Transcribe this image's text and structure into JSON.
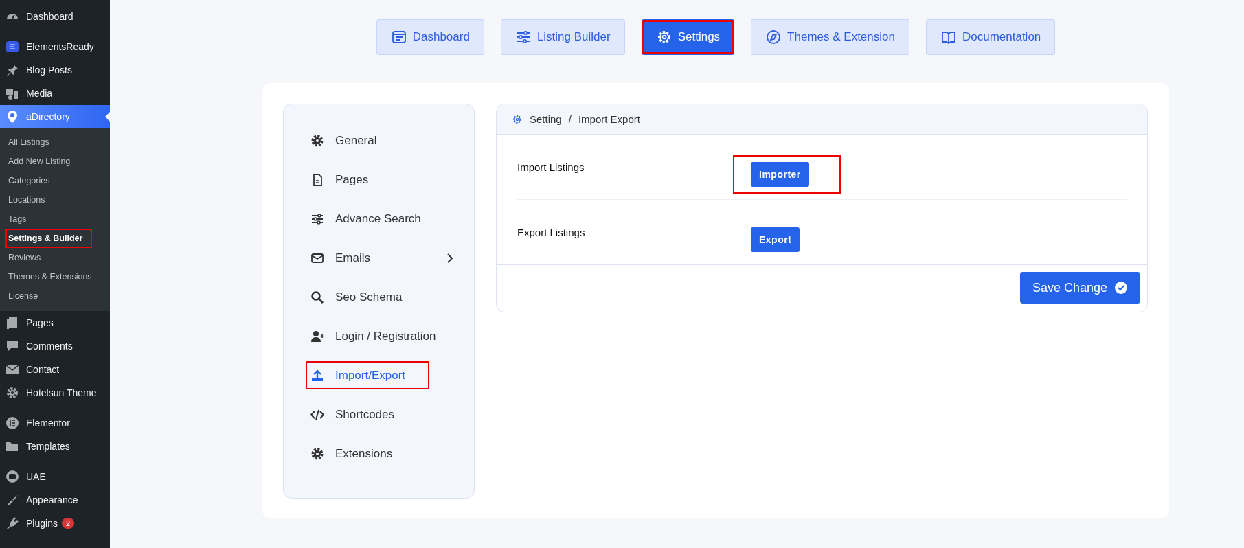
{
  "admin_menu": {
    "groups": [
      [
        {
          "label": "Dashboard",
          "selected": false
        }
      ],
      [
        {
          "label": "ElementsReady",
          "selected": false
        },
        {
          "label": "Blog Posts",
          "selected": false
        },
        {
          "label": "Media",
          "selected": false
        },
        {
          "label": "aDirectory",
          "selected": true,
          "submenu": [
            {
              "label": "All Listings",
              "selected": false,
              "highlighted": false
            },
            {
              "label": "Add New Listing",
              "selected": false,
              "highlighted": false
            },
            {
              "label": "Categories",
              "selected": false,
              "highlighted": false
            },
            {
              "label": "Locations",
              "selected": false,
              "highlighted": false
            },
            {
              "label": "Tags",
              "selected": false,
              "highlighted": false
            },
            {
              "label": "Settings & Builder",
              "selected": true,
              "highlighted": true
            },
            {
              "label": "Reviews",
              "selected": false,
              "highlighted": false
            },
            {
              "label": "Themes & Extensions",
              "selected": false,
              "highlighted": false
            },
            {
              "label": "License",
              "selected": false,
              "highlighted": false
            }
          ]
        },
        {
          "label": "Pages",
          "selected": false
        },
        {
          "label": "Comments",
          "selected": false
        },
        {
          "label": "Contact",
          "selected": false
        },
        {
          "label": "Hotelsun Theme",
          "selected": false
        }
      ],
      [
        {
          "label": "Elementor",
          "selected": false
        },
        {
          "label": "Templates",
          "selected": false
        }
      ],
      [
        {
          "label": "UAE",
          "selected": false
        },
        {
          "label": "Appearance",
          "selected": false
        },
        {
          "label": "Plugins",
          "selected": false,
          "badge": "2"
        }
      ]
    ]
  },
  "tabs": [
    {
      "label": "Dashboard",
      "selected": false,
      "highlighted": false
    },
    {
      "label": "Listing Builder",
      "selected": false,
      "highlighted": false
    },
    {
      "label": "Settings",
      "selected": true,
      "highlighted": true
    },
    {
      "label": "Themes & Extension",
      "selected": false,
      "highlighted": false
    },
    {
      "label": "Documentation",
      "selected": false,
      "highlighted": false
    }
  ],
  "settings_menu": [
    {
      "label": "General",
      "selected": false,
      "highlighted": false
    },
    {
      "label": "Pages",
      "selected": false,
      "highlighted": false
    },
    {
      "label": "Advance Search",
      "selected": false,
      "highlighted": false
    },
    {
      "label": "Emails",
      "selected": false,
      "highlighted": false,
      "has_submenu": true
    },
    {
      "label": "Seo Schema",
      "selected": false,
      "highlighted": false
    },
    {
      "label": "Login / Registration",
      "selected": false,
      "highlighted": false
    },
    {
      "label": "Import/Export",
      "selected": true,
      "highlighted": true
    },
    {
      "label": "Shortcodes",
      "selected": false,
      "highlighted": false
    },
    {
      "label": "Extensions",
      "selected": false,
      "highlighted": false
    }
  ],
  "panel": {
    "breadcrumb": [
      "Setting",
      "Import Export"
    ],
    "breadcrumb_separator": "/",
    "rows": [
      {
        "label": "Import Listings",
        "button": "Importer",
        "highlighted": true
      },
      {
        "label": "Export Listings",
        "button": "Export",
        "highlighted": false
      }
    ],
    "save_button": "Save Change"
  }
}
